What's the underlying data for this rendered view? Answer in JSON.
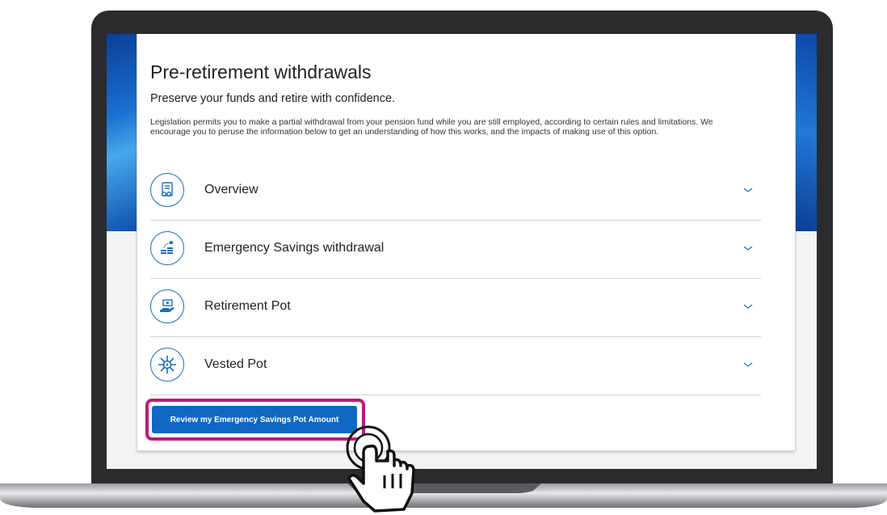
{
  "page": {
    "title": "Pre-retirement withdrawals",
    "subtitle": "Preserve your funds and retire with confidence.",
    "intro": "Legislation permits you to make a partial withdrawal from your pension fund while you are still employed, according to certain rules and limitations. We encourage you to peruse the information below to get an understanding of how this works, and the impacts of making use of this option."
  },
  "accordion": {
    "items": [
      {
        "label": "Overview",
        "icon": "document-glasses-icon"
      },
      {
        "label": "Emergency Savings withdrawal",
        "icon": "coins-stack-icon"
      },
      {
        "label": "Retirement Pot",
        "icon": "hand-money-icon"
      },
      {
        "label": "Vested Pot",
        "icon": "snowflake-lock-icon"
      }
    ]
  },
  "cta": {
    "label": "Review my Emergency Savings Pot Amount"
  },
  "colors": {
    "accent": "#1068c4",
    "highlight": "#c2187a",
    "icon": "#1c6dc0"
  }
}
